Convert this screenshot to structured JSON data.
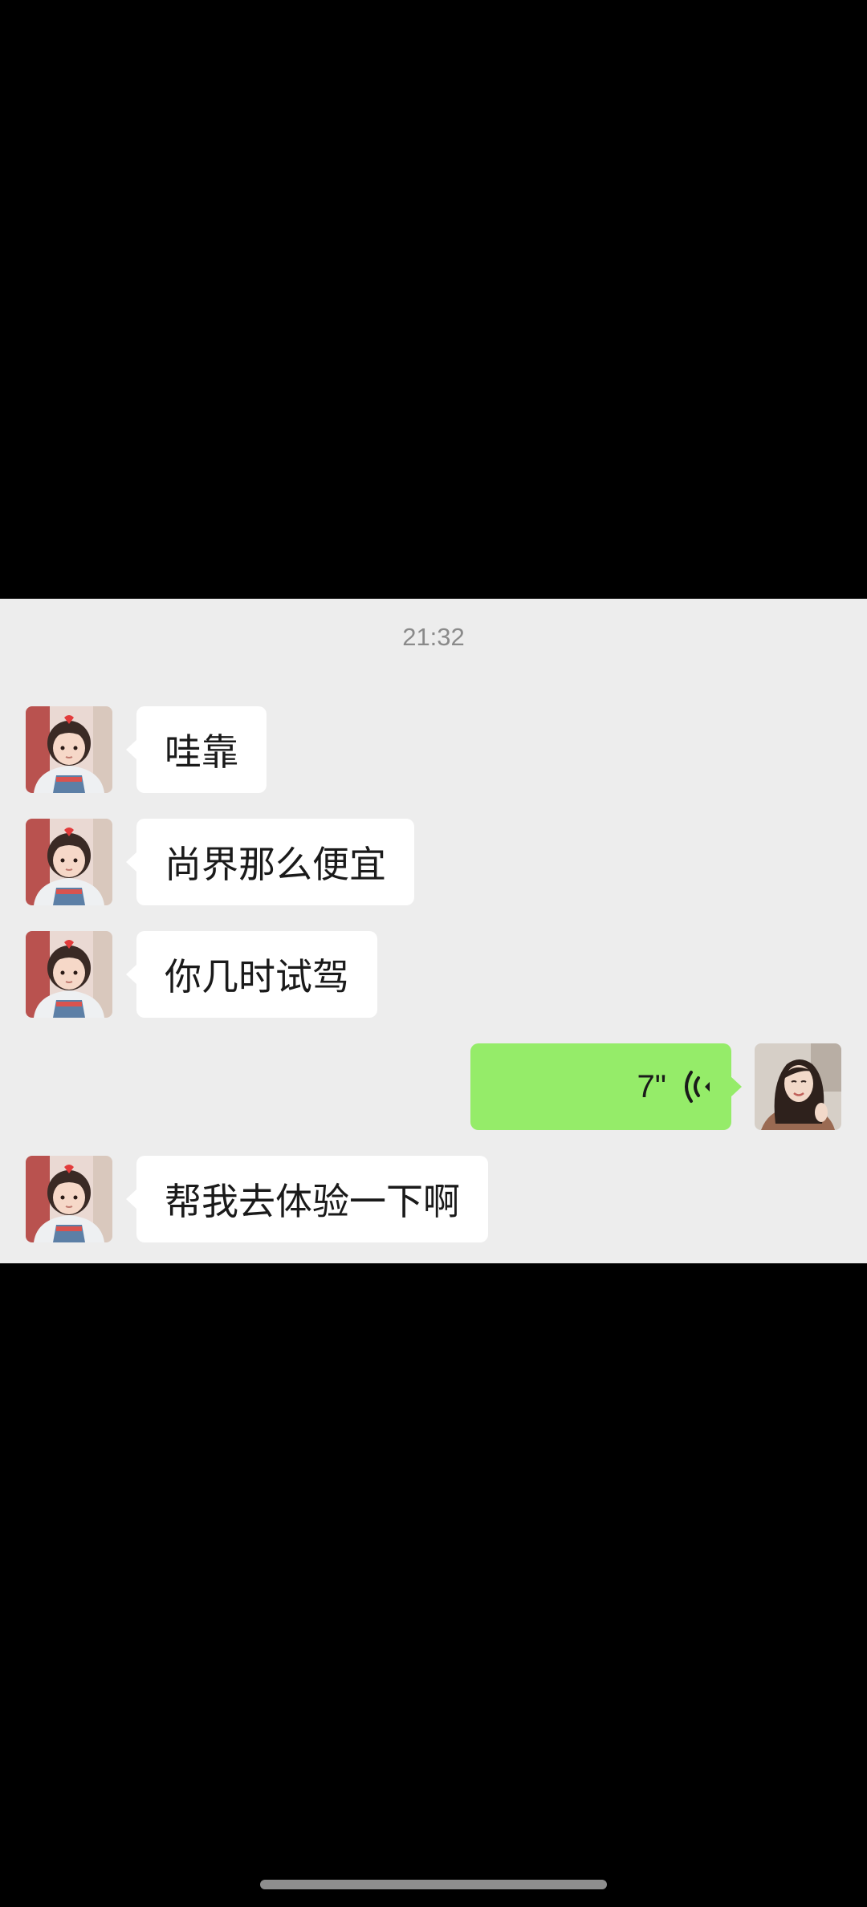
{
  "chat": {
    "timestamp": "21:32",
    "messages": [
      {
        "sender": "contact",
        "type": "text",
        "text": "哇靠"
      },
      {
        "sender": "contact",
        "type": "text",
        "text": "尚界那么便宜"
      },
      {
        "sender": "contact",
        "type": "text",
        "text": "你几时试驾"
      },
      {
        "sender": "me",
        "type": "voice",
        "duration": "7\""
      },
      {
        "sender": "contact",
        "type": "text",
        "text": "帮我去体验一下啊"
      }
    ]
  },
  "colors": {
    "chat_background": "#ededed",
    "incoming_bubble": "#ffffff",
    "outgoing_bubble": "#95ec69",
    "timestamp_text": "#8a8a8a"
  },
  "icons": {
    "voice": "voice-wave-icon",
    "contact_avatar": "child-avatar-icon",
    "my_avatar": "woman-avatar-icon"
  }
}
